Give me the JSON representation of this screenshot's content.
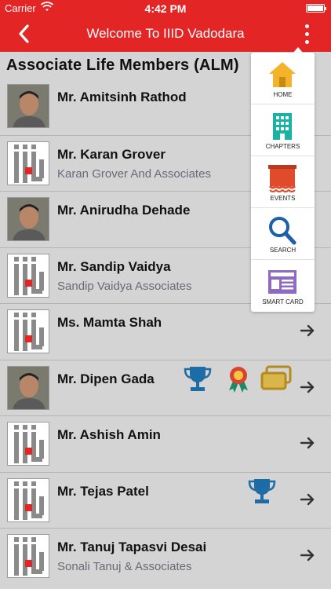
{
  "status": {
    "carrier": "Carrier",
    "time": "4:42 PM"
  },
  "nav": {
    "title": "Welcome To IIID Vadodara"
  },
  "section_title": "Associate Life Members (ALM)",
  "members": [
    {
      "name": "Mr. Amitsinh Rathod",
      "firm": "",
      "photo": "photo",
      "arrow": false,
      "awards": []
    },
    {
      "name": "Mr. Karan Grover",
      "firm": "Karan Grover And Associates",
      "photo": "logo",
      "arrow": false,
      "awards": []
    },
    {
      "name": "Mr. Anirudha Dehade",
      "firm": "",
      "photo": "photo",
      "arrow": false,
      "awards": []
    },
    {
      "name": "Mr. Sandip Vaidya",
      "firm": "Sandip Vaidya Associates",
      "photo": "logo",
      "arrow": false,
      "awards": []
    },
    {
      "name": "Ms. Mamta Shah",
      "firm": "",
      "photo": "logo",
      "arrow": true,
      "awards": []
    },
    {
      "name": "Mr. Dipen Gada",
      "firm": "",
      "photo": "photo",
      "arrow": true,
      "awards": [
        "trophy",
        "medal",
        "card"
      ]
    },
    {
      "name": "Mr. Ashish Amin",
      "firm": "",
      "photo": "logo",
      "arrow": true,
      "awards": []
    },
    {
      "name": "Mr. Tejas Patel",
      "firm": "",
      "photo": "logo",
      "arrow": true,
      "awards": [
        "trophy"
      ]
    },
    {
      "name": "Mr. Tanuj Tapasvi Desai",
      "firm": "Sonali Tanuj & Associates",
      "photo": "logo",
      "arrow": true,
      "awards": []
    }
  ],
  "menu": [
    {
      "label": "HOME",
      "icon": "home-icon"
    },
    {
      "label": "CHAPTERS",
      "icon": "building-icon"
    },
    {
      "label": "EVENTS",
      "icon": "events-icon"
    },
    {
      "label": "SEARCH",
      "icon": "search-icon"
    },
    {
      "label": "SMART CARD",
      "icon": "smart-card-icon"
    }
  ],
  "colors": {
    "brand_red": "#e32526",
    "trophy_blue": "#1c6ca6",
    "home_yellow": "#f3b32a",
    "chapters_teal": "#19b3a6",
    "events_red": "#e04b2b",
    "search_blue": "#1d5fa8",
    "card_purple": "#8e6bbf"
  }
}
